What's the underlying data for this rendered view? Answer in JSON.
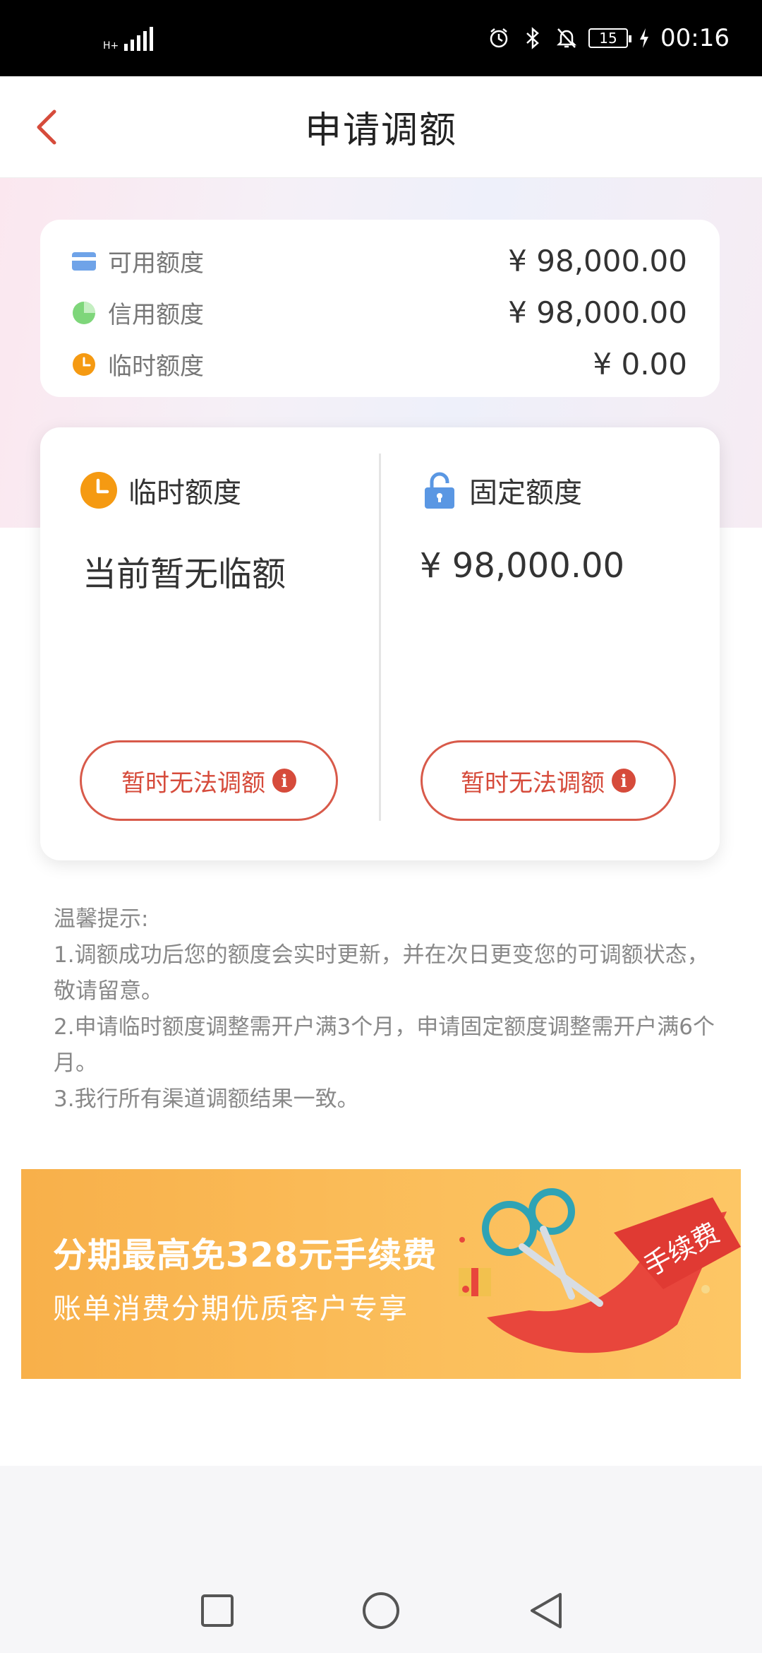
{
  "status_bar": {
    "network": "H+",
    "battery": "15",
    "time": "00:16"
  },
  "header": {
    "title": "申请调额"
  },
  "summary": {
    "rows": [
      {
        "label": "可用额度",
        "value": "¥ 98,000.00",
        "icon": "card-icon"
      },
      {
        "label": "信用额度",
        "value": "¥ 98,000.00",
        "icon": "pie-icon"
      },
      {
        "label": "临时额度",
        "value": "¥ 0.00",
        "icon": "clock-icon"
      }
    ]
  },
  "quota": {
    "temporary": {
      "label": "临时额度",
      "value": "当前暂无临额",
      "button": "暂时无法调额",
      "icon": "clock-icon"
    },
    "fixed": {
      "label": "固定额度",
      "value": "¥ 98,000.00",
      "button": "暂时无法调额",
      "icon": "lock-icon"
    }
  },
  "tips": {
    "title": "温馨提示:",
    "items": [
      "1.调额成功后您的额度会实时更新，并在次日更变您的可调额状态，敬请留意。",
      "2.申请临时额度调整需开户满3个月，申请固定额度调整需开户满6个月。",
      "3.我行所有渠道调额结果一致。"
    ]
  },
  "banner": {
    "title": "分期最高免328元手续费",
    "subtitle": "账单消费分期优质客户专享",
    "ribbon_text": "手续费"
  },
  "colors": {
    "accent": "#d64b3b",
    "orange": "#f59a12",
    "green": "#7ed67a",
    "blue": "#6fa3e8"
  }
}
